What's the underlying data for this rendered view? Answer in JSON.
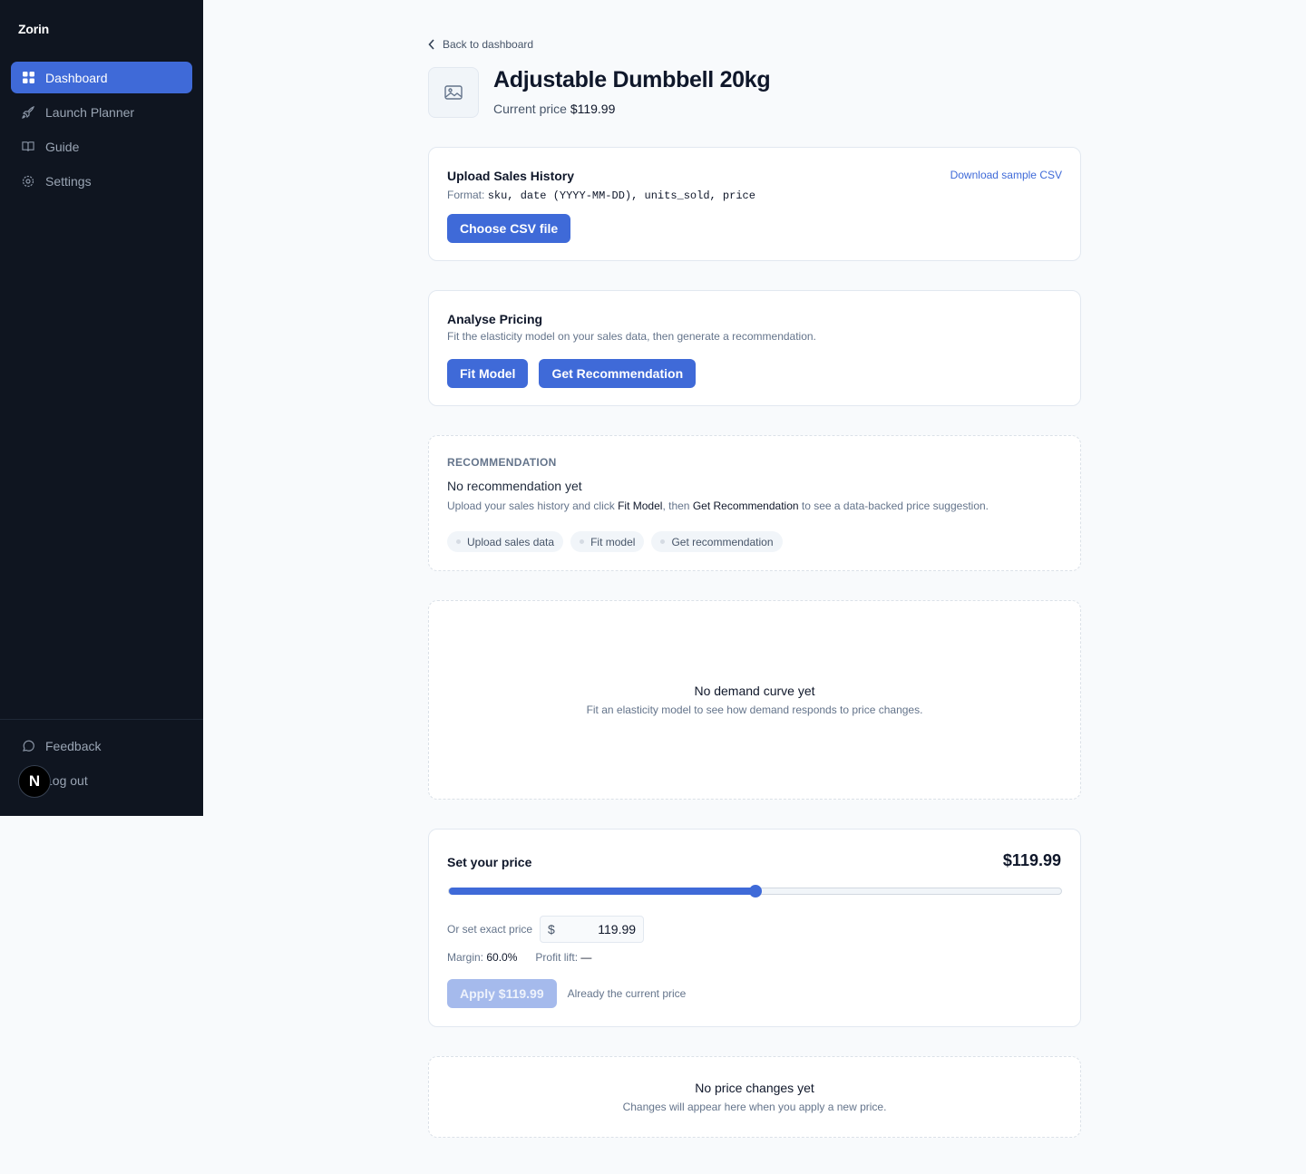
{
  "sidebar": {
    "brand": "Zorin",
    "items": [
      {
        "label": "Dashboard",
        "icon": "grid-icon",
        "active": true
      },
      {
        "label": "Launch Planner",
        "icon": "rocket-icon",
        "active": false
      },
      {
        "label": "Guide",
        "icon": "book-icon",
        "active": false
      },
      {
        "label": "Settings",
        "icon": "gear-icon",
        "active": false
      }
    ],
    "bottom": [
      {
        "label": "Feedback",
        "icon": "chat-bubble-icon"
      },
      {
        "label": "Log out",
        "icon": "logout-icon"
      }
    ],
    "avatar_letter": "N"
  },
  "header": {
    "back_label": "Back to dashboard",
    "product_title": "Adjustable Dumbbell 20kg",
    "current_price_label": "Current price",
    "current_price_value": "$119.99"
  },
  "upload": {
    "title": "Upload Sales History",
    "format_label": "Format:",
    "format_value": "sku, date (YYYY-MM-DD), units_sold, price",
    "download_label": "Download sample CSV",
    "button_label": "Choose CSV file"
  },
  "analyse": {
    "title": "Analyse Pricing",
    "description": "Fit the elasticity model on your sales data, then generate a recommendation.",
    "fit_label": "Fit Model",
    "recommend_label": "Get Recommendation"
  },
  "recommendation": {
    "label": "RECOMMENDATION",
    "headline": "No recommendation yet",
    "sub_part1": "Upload your sales history and click ",
    "sub_bold1": "Fit Model",
    "sub_part2": ", then ",
    "sub_bold2": "Get Recommendation",
    "sub_part3": " to see a data-backed price suggestion.",
    "steps": [
      "Upload sales data",
      "Fit model",
      "Get recommendation"
    ]
  },
  "demand_curve": {
    "title": "No demand curve yet",
    "subtitle": "Fit an elasticity model to see how demand responds to price changes."
  },
  "set_price": {
    "title": "Set your price",
    "display_value": "$119.99",
    "slider_fraction": 0.5,
    "exact_label": "Or set exact price",
    "currency": "$",
    "input_value": "119.99",
    "margin_label": "Margin:",
    "margin_value": "60.0%",
    "profit_label": "Profit lift:",
    "profit_value": "—",
    "apply_label": "Apply $119.99",
    "apply_note": "Already the current price"
  },
  "history": {
    "title": "No price changes yet",
    "subtitle": "Changes will appear here when you apply a new price."
  },
  "colors": {
    "accent": "#3f6ad8",
    "sidebar_bg": "#0f1520",
    "page_bg": "#f8fafc"
  }
}
